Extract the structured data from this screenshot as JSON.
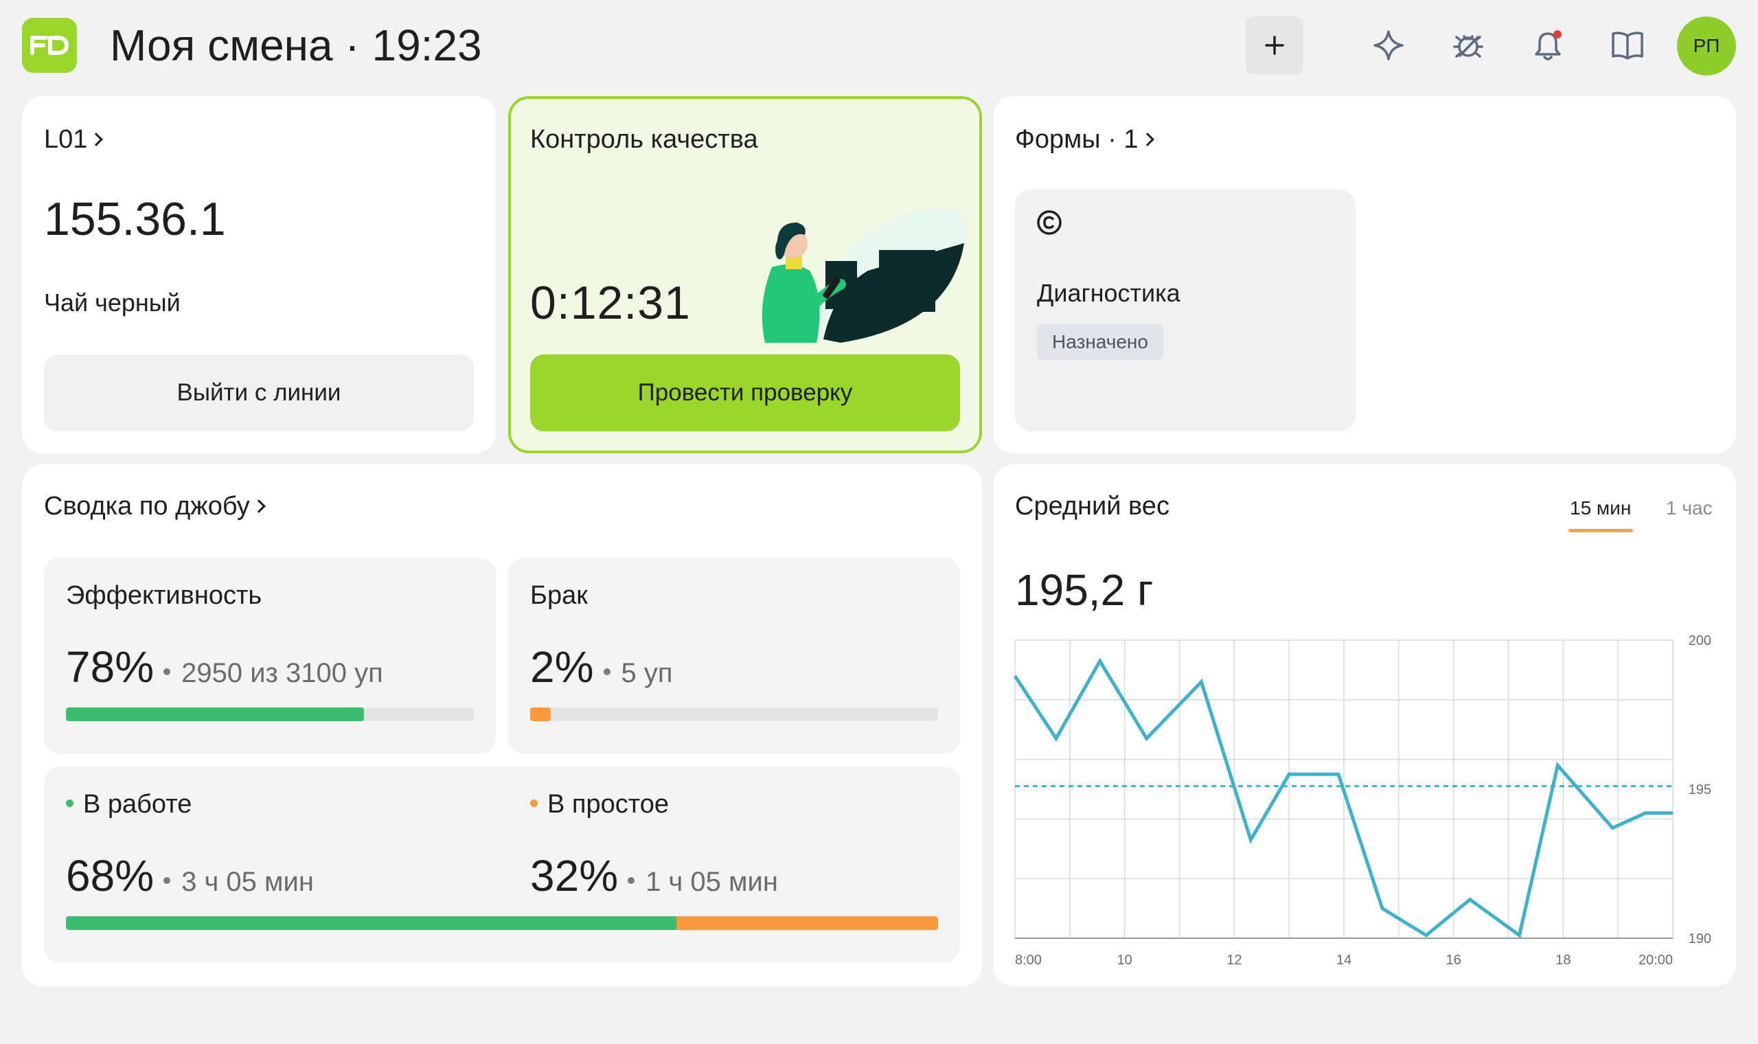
{
  "header": {
    "logo_text": "FD",
    "title": "Моя смена · 19:23",
    "add_label": "+",
    "icons": [
      "plus-icon",
      "sparkle-icon",
      "bug-icon",
      "bell-icon",
      "book-icon"
    ],
    "avatar_initials": "РП",
    "notification_dot_color": "#e53935"
  },
  "line_card": {
    "title": "L01",
    "code": "155.36.1",
    "product": "Чай черный",
    "exit_button": "Выйти с линии"
  },
  "qc_card": {
    "title": "Контроль качества",
    "timer": "0:12:31",
    "check_button": "Провести проверку",
    "accent_color": "#9ad52b"
  },
  "forms_card": {
    "title": "Формы · 1",
    "form": {
      "name": "Диагностика",
      "status": "Назначено"
    }
  },
  "job_summary": {
    "title": "Сводка по джобу",
    "efficiency": {
      "label": "Эффективность",
      "value": "78%",
      "detail": "2950 из 3100 уп",
      "fraction": 0.73,
      "color": "#3dbb6e"
    },
    "defect": {
      "label": "Брак",
      "value": "2%",
      "detail": "5 уп",
      "fraction": 0.05,
      "color": "#f89a3d"
    },
    "working": {
      "label": "В работе",
      "value": "68%",
      "detail": "3 ч 05 мин",
      "fraction": 0.7,
      "color": "#3dbb6e"
    },
    "idle": {
      "label": "В простое",
      "value": "32%",
      "detail": "1 ч 05 мин",
      "color": "#f89a3d"
    }
  },
  "avg_weight": {
    "title": "Средний вес",
    "value": "195,2 г",
    "tabs": [
      "15 мин",
      "1 час"
    ],
    "active_tab": "15 мин"
  },
  "chart_data": {
    "type": "line",
    "title": "",
    "xlabel": "",
    "ylabel": "",
    "x_tick_labels": [
      "8:00",
      "10",
      "12",
      "14",
      "16",
      "18",
      "20:00"
    ],
    "x_ticks": [
      8,
      10,
      12,
      14,
      16,
      18,
      20
    ],
    "y_tick_labels": [
      "200",
      "195",
      "190"
    ],
    "y_ticks": [
      200,
      195,
      190
    ],
    "xlim": [
      8,
      20
    ],
    "ylim": [
      190,
      200
    ],
    "grid": true,
    "series": [
      {
        "color": "#3fb1cb",
        "x": [
          8.0,
          8.75,
          9.55,
          10.4,
          11.4,
          12.3,
          13.0,
          13.9,
          14.7,
          15.5,
          16.3,
          17.2,
          17.9,
          18.9,
          19.5,
          20.0
        ],
        "y": [
          198.8,
          196.7,
          199.3,
          196.7,
          198.6,
          193.3,
          195.5,
          195.5,
          191.0,
          190.1,
          191.3,
          190.1,
          195.8,
          193.7,
          194.2,
          194.2
        ]
      }
    ],
    "reference_line": {
      "y": 195.1,
      "style": "dashed",
      "color": "#3fb1cb"
    }
  }
}
